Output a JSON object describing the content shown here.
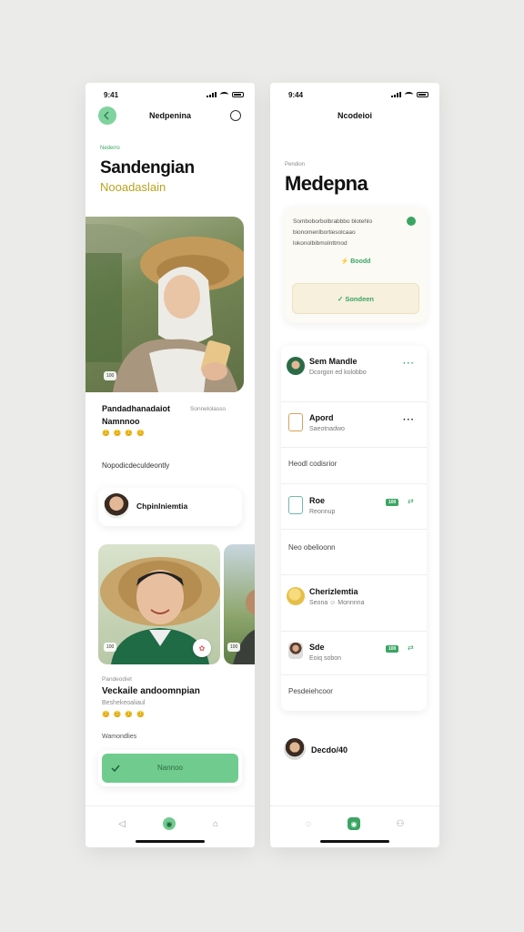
{
  "left": {
    "status_time": "9:41",
    "nav_title": "Nedpenina",
    "eyebrow": "Nederro",
    "title": "Sandengian",
    "subtitle": "Nooadaslain",
    "photo1_badge": "100",
    "card1": {
      "name": "Pandadhanadaiot",
      "name2": "Namnnoo",
      "meta": "Sonnelolasso",
      "emojis": "😊 😊 😊 😊"
    },
    "section_label": "Nopodicdeculdeontly",
    "contact": {
      "name": "Chpinlniemtia"
    },
    "photo2_badge": "100",
    "photo3_badge": "100",
    "card2": {
      "eyebrow": "Pandeodiet",
      "title": "Veckaile andoomnpian",
      "sub": "Beshekeoaliaul",
      "emojis": "😊 😊 😊 😊"
    },
    "footer_label": "Wamondlies",
    "cta_label": "Nannoo",
    "colors": {
      "accent": "#6fcc8e",
      "accent_dark": "#3aa563"
    }
  },
  "right": {
    "status_time": "9:44",
    "nav_title": "Ncodeioi",
    "eyebrow": "Pendion",
    "title": "Medepna",
    "info_text": "Somboborbolbrabbbo blotehlo bionomenlbortiesolcaao lokonolbibmolnttmod",
    "info_link": "Boodd",
    "info_button": "Sondeen",
    "rows": [
      {
        "title": "Sem Mandle",
        "sub": "Dcorgon ed kolobbo"
      },
      {
        "title": "Apord",
        "sub": "Saeotnadwo"
      },
      {
        "title": "Heodl codisrior"
      },
      {
        "title": "Roe",
        "sub": "Reonnup",
        "pill": "100"
      },
      {
        "title": "Neo obelioonn"
      },
      {
        "title": "Cherizlemtia",
        "sub": "Seona ☺ Monnnna"
      },
      {
        "title": "Sde",
        "sub": "Eoiq sobon",
        "pill": "100"
      },
      {
        "title": "Pesdeiehcoor"
      }
    ],
    "footer_name": "Decdo/40"
  }
}
